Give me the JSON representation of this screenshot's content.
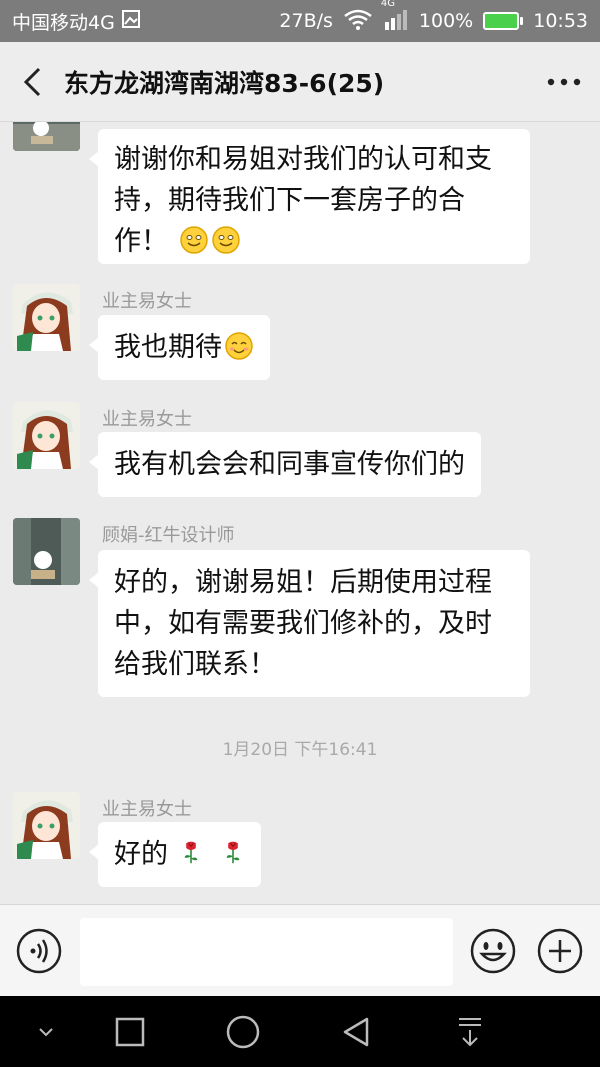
{
  "status_bar": {
    "carrier": "中国移动4G",
    "speed": "27B/s",
    "network_type": "4G",
    "battery": "100%",
    "time": "10:53"
  },
  "header": {
    "title": "东方龙湖湾南湖湾83-6",
    "title_suffix": "(25)"
  },
  "messages": [
    {
      "type": "received",
      "sender": "",
      "text": "谢谢你和易姐对我们的认可和支持，期待我们下一套房子的合作！",
      "emoji": [
        "smile",
        "smile"
      ]
    },
    {
      "type": "received",
      "sender": "业主易女士",
      "text": "我也期待",
      "emoji": [
        "blush"
      ]
    },
    {
      "type": "received",
      "sender": "业主易女士",
      "text": "我有机会会和同事宣传你们的",
      "emoji": []
    },
    {
      "type": "received",
      "sender": "顾娟-红牛设计师",
      "text": "好的，谢谢易姐！后期使用过程中，如有需要我们修补的，及时给我们联系！",
      "emoji": []
    },
    {
      "type": "received",
      "sender": "业主易女士",
      "text": "好的",
      "emoji": [
        "rose",
        "rose"
      ]
    }
  ],
  "timestamp": "1月20日 下午16:41",
  "colors": {
    "status_bar_bg": "#7c7c7c",
    "chat_bg": "#ebebeb",
    "bubble_bg": "#ffffff",
    "battery_fill": "#4bd04b"
  },
  "icons": {
    "back": "chevron-left-icon",
    "more": "more-horizontal-icon",
    "voice": "voice-icon",
    "emoji": "emoji-face-icon",
    "add": "plus-circle-icon"
  }
}
